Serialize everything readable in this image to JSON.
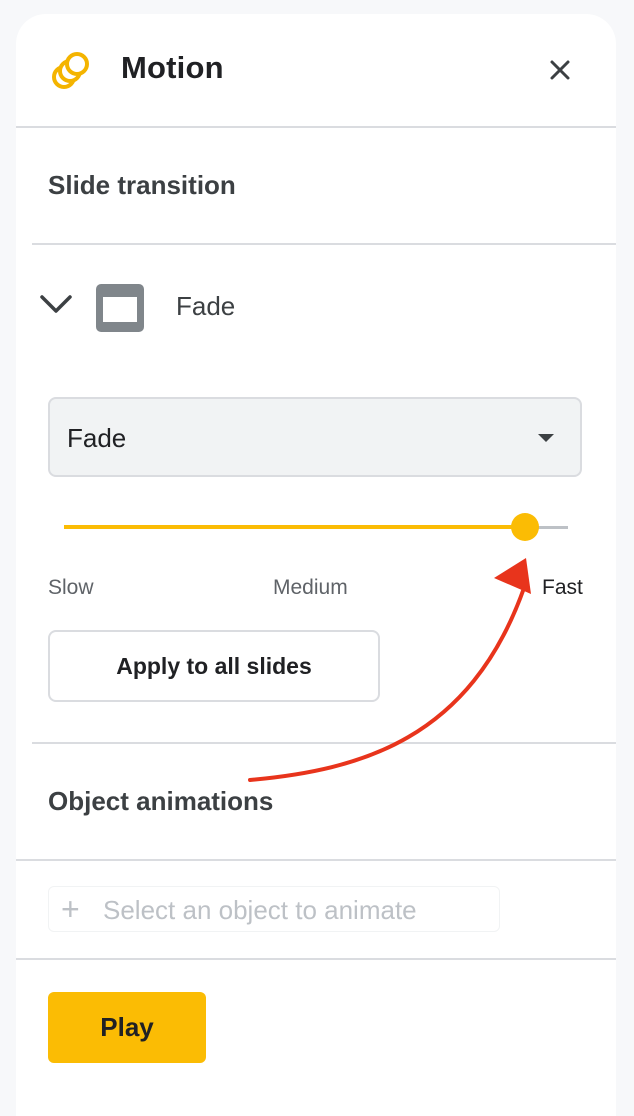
{
  "header": {
    "title": "Motion",
    "logo_icon": "motion-circles-icon",
    "close_icon": "close-icon"
  },
  "slide_transition": {
    "section_title": "Slide transition",
    "transition_name": "Fade",
    "select_value": "Fade",
    "speed": {
      "value_fraction": 0.915,
      "labels": [
        "Slow",
        "Medium",
        "Fast"
      ]
    },
    "apply_label": "Apply to all slides"
  },
  "object_animations": {
    "section_title": "Object animations",
    "add_placeholder": "Select an object to animate"
  },
  "footer": {
    "play_label": "Play"
  },
  "colors": {
    "accent": "#fbbc04",
    "annotation_arrow": "#e8341c"
  }
}
